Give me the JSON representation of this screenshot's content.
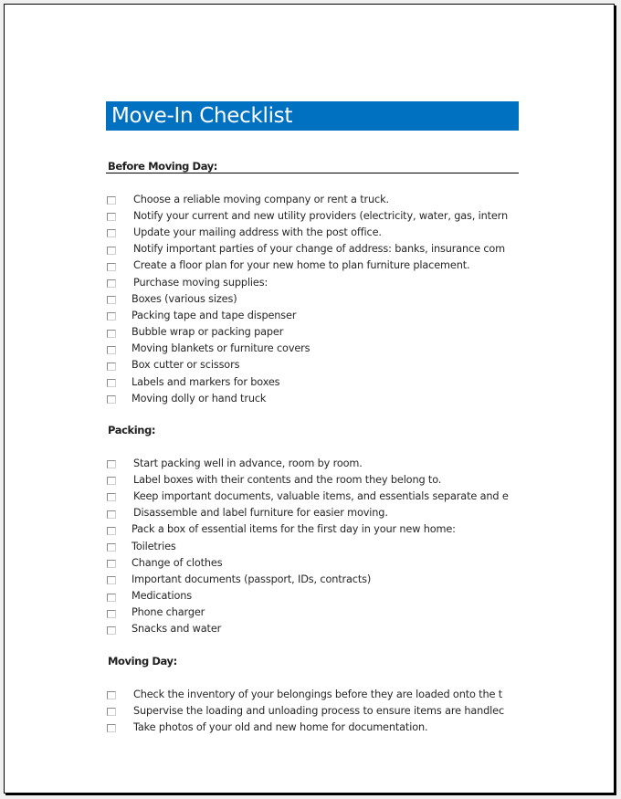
{
  "document": {
    "title": "Move-In Checklist",
    "sections": [
      {
        "heading": "Before Moving Day:",
        "items": [
          {
            "text": "Choose a reliable moving company or rent a truck.",
            "checked": false,
            "sub": false
          },
          {
            "text": "Notify your current and new utility providers (electricity, water, gas, intern",
            "checked": false,
            "sub": false
          },
          {
            "text": "Update your mailing address with the post office.",
            "checked": false,
            "sub": false
          },
          {
            "text": "Notify important parties of your change of address: banks, insurance com",
            "checked": false,
            "sub": false
          },
          {
            "text": "Create a floor plan for your new home to plan furniture placement.",
            "checked": false,
            "sub": false
          },
          {
            "text": "Purchase moving supplies:",
            "checked": false,
            "sub": false
          },
          {
            "text": "Boxes (various sizes)",
            "checked": false,
            "sub": true
          },
          {
            "text": "Packing tape and tape dispenser",
            "checked": false,
            "sub": true
          },
          {
            "text": "Bubble wrap or packing paper",
            "checked": false,
            "sub": true
          },
          {
            "text": "Moving blankets or furniture covers",
            "checked": false,
            "sub": true
          },
          {
            "text": "Box cutter or scissors",
            "checked": false,
            "sub": true
          },
          {
            "text": "Labels and markers for boxes",
            "checked": false,
            "sub": true
          },
          {
            "text": "Moving dolly or hand truck",
            "checked": false,
            "sub": true
          }
        ]
      },
      {
        "heading": "Packing:",
        "items": [
          {
            "text": "Start packing well in advance, room by room.",
            "checked": false,
            "sub": false
          },
          {
            "text": "Label boxes with their contents and the room they belong to.",
            "checked": false,
            "sub": false
          },
          {
            "text": "Keep important documents, valuable items, and essentials separate and e",
            "checked": false,
            "sub": false
          },
          {
            "text": "Disassemble and label furniture for easier moving.",
            "checked": false,
            "sub": false
          },
          {
            "text": "Pack a box of essential items for the first day in your new home:",
            "checked": false,
            "sub": true
          },
          {
            "text": "Toiletries",
            "checked": false,
            "sub": true
          },
          {
            "text": "Change of clothes",
            "checked": false,
            "sub": true
          },
          {
            "text": "Important documents (passport, IDs, contracts)",
            "checked": false,
            "sub": true
          },
          {
            "text": "Medications",
            "checked": false,
            "sub": true
          },
          {
            "text": "Phone charger",
            "checked": false,
            "sub": true
          },
          {
            "text": "Snacks and water",
            "checked": false,
            "sub": true
          }
        ]
      },
      {
        "heading": "Moving Day:",
        "items": [
          {
            "text": "Check the inventory of your belongings before they are loaded onto the t",
            "checked": false,
            "sub": false
          },
          {
            "text": "Supervise the loading and unloading process to ensure items are handlec",
            "checked": false,
            "sub": false
          },
          {
            "text": "Take photos of your old and new home for documentation.",
            "checked": false,
            "sub": false
          }
        ]
      }
    ]
  },
  "colors": {
    "title_background": "#0070c0",
    "title_text": "#ffffff",
    "body_text": "#262626",
    "page_background": "#f0f0f0"
  }
}
